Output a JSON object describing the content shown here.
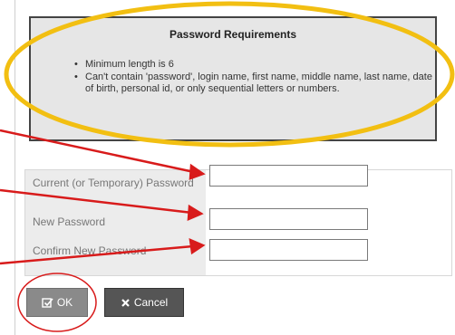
{
  "requirements": {
    "title": "Password Requirements",
    "items": [
      {
        "bullet": "•",
        "text": "Minimum length is 6"
      },
      {
        "bullet": "•",
        "text": "Can't contain 'password', login name, first name, middle name, last name, date of birth, personal id, or only sequential letters or numbers."
      }
    ]
  },
  "form": {
    "current_label": "Current (or Temporary) Password",
    "new_label": "New Password",
    "confirm_label": "Confirm New Password",
    "current_value": "",
    "new_value": "",
    "confirm_value": ""
  },
  "buttons": {
    "ok_label": "OK",
    "cancel_label": "Cancel"
  },
  "icons": {
    "ok": "checkbox-icon",
    "cancel": "x-icon"
  },
  "colors": {
    "annotation_ellipse": "#f2bf12",
    "annotation_arrow": "#d81b1b",
    "annotation_circle": "#d81b1b"
  }
}
